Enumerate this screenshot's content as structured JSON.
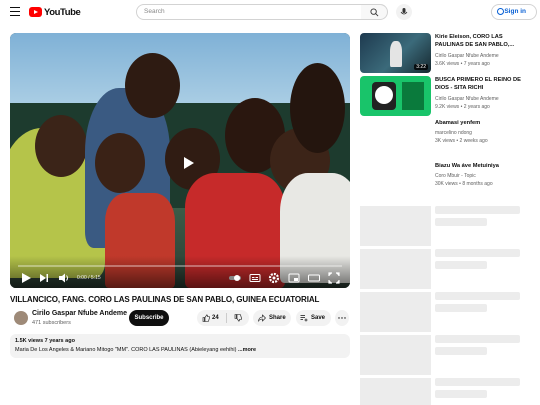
{
  "masthead": {
    "logo_text": "YouTube",
    "search_placeholder": "Search",
    "signin_label": "Sign in"
  },
  "player": {
    "time_current": "0:00",
    "time_total": "5:15",
    "progress": 0
  },
  "video": {
    "title": "VILLANCICO, FANG. CORO LAS PAULINAS DE SAN PABLO, GUINEA ECUATORIAL",
    "channel": "Cirilo Gaspar Nfube Andeme",
    "subscribers": "471 subscribers",
    "subscribe_label": "Subscribe",
    "likes": "24",
    "share_label": "Share",
    "save_label": "Save"
  },
  "description": {
    "meta": "1.5K views  7 years ago",
    "text": "Maria De Los Angeles & Mariano Mitogo \"MM\". CORO LAS PAULINAS (Abieleyang eehihi)",
    "more_label": "...more"
  },
  "recommendations": [
    {
      "title": "Kirie Eleison, CORO LAS PAULINAS DE SAN PABLO,...",
      "channel": "Cirilo Gaspar Nfube Andeme",
      "stats": "3.6K views • 7 years ago",
      "duration": "3:22"
    },
    {
      "title": "BUSCA PRIMERO EL REINO DE DIOS - SITA RICHI",
      "channel": "Cirilo Gaspar Nfube Andeme",
      "stats": "9.2K views • 2 years ago",
      "duration": ""
    },
    {
      "title": "Abamasi yenfem",
      "channel": "marcelino ndong",
      "stats": "3K views • 2 weeks ago",
      "duration": ""
    },
    {
      "title": "Biazu Wa áve Metuiniya",
      "channel": "Coro Mbuir - Topic",
      "stats": "30K views • 8 months ago",
      "duration": ""
    }
  ],
  "colors": {
    "brand_red": "#ff0000",
    "link_blue": "#065fd4",
    "button_black": "#0f0f0f"
  }
}
